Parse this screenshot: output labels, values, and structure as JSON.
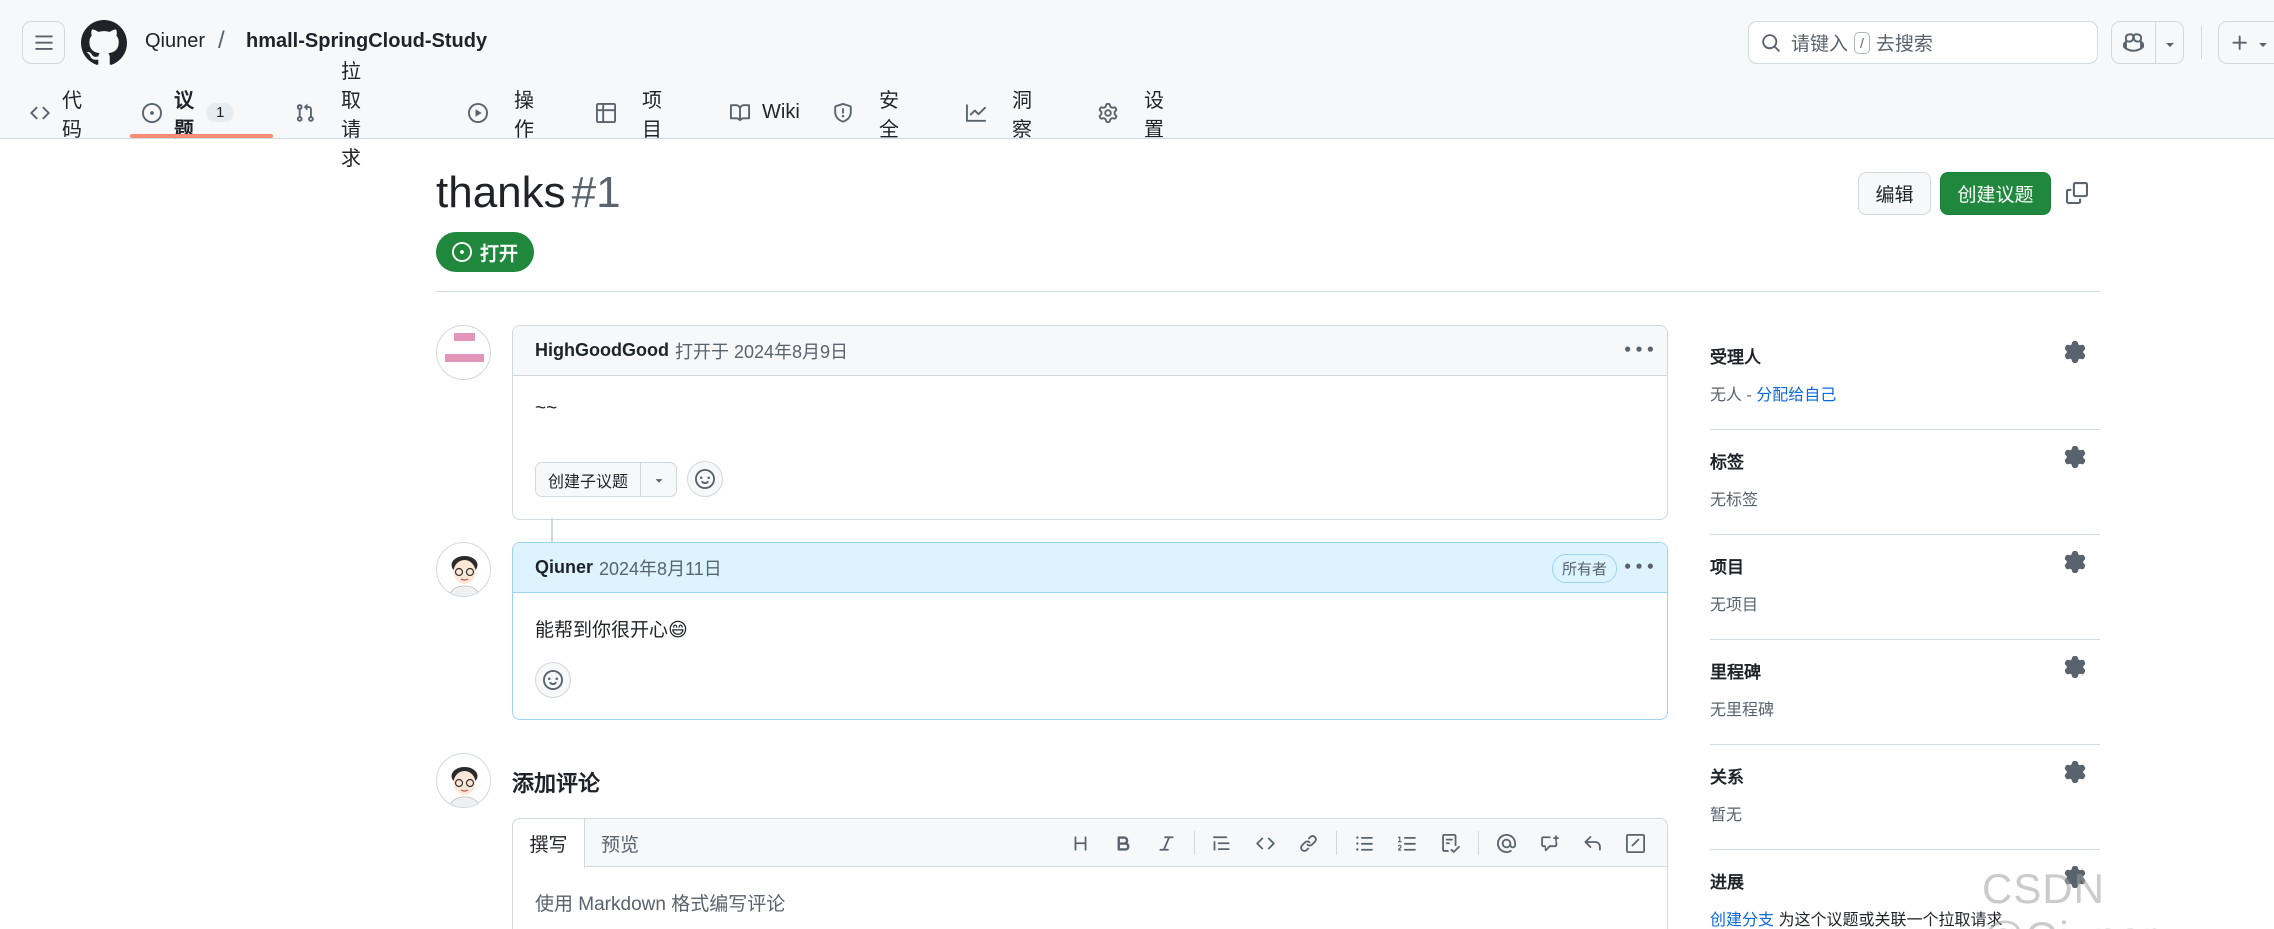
{
  "header": {
    "owner": "Qiuner",
    "separator": "/",
    "repo": "hmall-SpringCloud-Study",
    "search_label": "请键入",
    "search_key": "/",
    "search_suffix": "去搜索"
  },
  "tabs": [
    {
      "label": "代码",
      "icon": "code-icon"
    },
    {
      "label": "议题",
      "icon": "issue-opened-icon",
      "count": "1",
      "active": true
    },
    {
      "label": "拉取请求",
      "icon": "git-pull-request-icon"
    },
    {
      "label": "操作",
      "icon": "play-icon"
    },
    {
      "label": "项目",
      "icon": "table-icon"
    },
    {
      "label": "Wiki",
      "icon": "book-icon"
    },
    {
      "label": "安全",
      "icon": "shield-icon"
    },
    {
      "label": "洞察",
      "icon": "graph-icon"
    },
    {
      "label": "设置",
      "icon": "gear-icon"
    }
  ],
  "issue": {
    "title": "thanks",
    "number": "#1",
    "state": "打开",
    "edit_label": "编辑",
    "new_label": "创建议题"
  },
  "comments": [
    {
      "author": "HighGoodGood",
      "meta": "打开于 2024年8月9日",
      "body": "~~",
      "sub_issue_label": "创建子议题"
    },
    {
      "author": "Qiuner",
      "meta": "2024年8月11日",
      "badge": "所有者",
      "body": "能帮到你很开心😄"
    }
  ],
  "composer": {
    "title": "添加评论",
    "tab_write": "撰写",
    "tab_preview": "预览",
    "placeholder": "使用 Markdown 格式编写评论",
    "tools": [
      "heading-icon",
      "bold-icon",
      "italic-icon",
      "quote-icon",
      "code-icon",
      "link-icon",
      "unordered-list-icon",
      "ordered-list-icon",
      "task-list-icon",
      "mention-icon",
      "cross-reference-icon",
      "reply-icon",
      "slash-icon"
    ]
  },
  "sidebar": {
    "assignees": {
      "label": "受理人",
      "value": "无人 - ",
      "link": "分配给自己"
    },
    "labels": {
      "label": "标签",
      "value": "无标签"
    },
    "projects": {
      "label": "项目",
      "value": "无项目"
    },
    "milestone": {
      "label": "里程碑",
      "value": "无里程碑"
    },
    "relationships": {
      "label": "关系",
      "value": "暂无"
    },
    "development": {
      "label": "进展",
      "link": "创建分支",
      "value": " 为这个议题或关联一个拉取请求"
    }
  },
  "watermark": "CSDN @Qiuner",
  "colors": {
    "accent_green": "#1f883d",
    "link_blue": "#0969da",
    "tab_underline": "#fd8c73",
    "owner_blue": "#ddf4ff"
  }
}
